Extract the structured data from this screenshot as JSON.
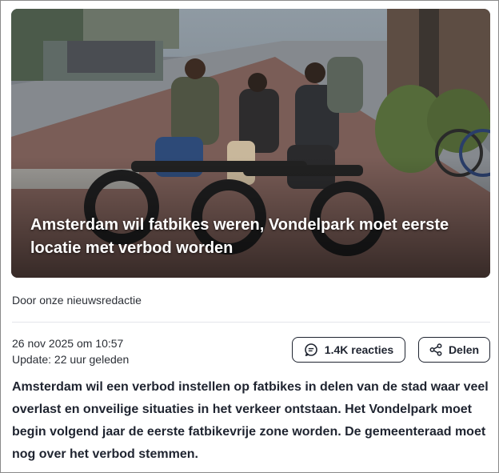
{
  "article": {
    "headline": "Amsterdam wil fatbikes weren, Vondelpark moet eerste locatie met verbod worden",
    "byline": "Door onze nieuwsredactie",
    "published": "26 nov 2025 om 10:57",
    "updated": "Update: 22 uur geleden",
    "lead": "Amsterdam wil een verbod instellen op fatbikes in delen van de stad waar veel overlast en onveilige situaties in het verkeer ontstaan. Het Vondelpark moet begin volgend jaar de eerste fatbikevrije zone worden. De gemeenteraad moet nog over het verbod stemmen."
  },
  "actions": {
    "comments_label": "1.4K reacties",
    "comments_icon": "chat-bubble-icon",
    "share_label": "Delen",
    "share_icon": "share-icon"
  },
  "colors": {
    "text": "#1f2430",
    "border": "#1f2430",
    "divider": "#e4e6ea",
    "overlay_text": "#ffffff"
  }
}
